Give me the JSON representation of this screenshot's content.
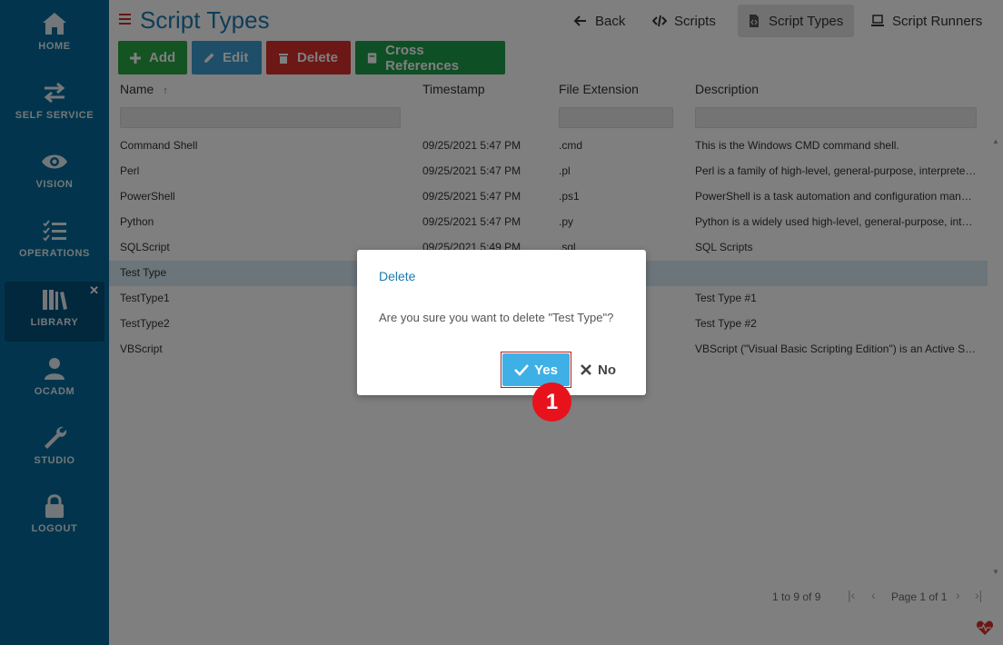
{
  "colors": {
    "sidebar": "#046b9a",
    "accent_blue": "#1a7ab0",
    "add_green": "#28a745",
    "edit_blue": "#3c9dd0",
    "delete_red": "#d9302c",
    "crossref_green": "#1e9e4a",
    "yes_button": "#3fb0e6",
    "badge_red": "#e8121c"
  },
  "sidebar": {
    "items": [
      {
        "label": "HOME",
        "icon": "home-icon"
      },
      {
        "label": "SELF SERVICE",
        "icon": "swap-arrows-icon"
      },
      {
        "label": "VISION",
        "icon": "eye-icon"
      },
      {
        "label": "OPERATIONS",
        "icon": "checklist-icon"
      },
      {
        "label": "LIBRARY",
        "icon": "books-icon",
        "active": true,
        "close": "✕"
      },
      {
        "label": "OCADM",
        "icon": "user-icon"
      },
      {
        "label": "STUDIO",
        "icon": "wrench-icon"
      },
      {
        "label": "LOGOUT",
        "icon": "lock-icon"
      }
    ]
  },
  "header": {
    "title": "Script Types",
    "links": [
      {
        "label": "Back",
        "icon": "arrow-left-icon"
      },
      {
        "label": "Scripts",
        "icon": "code-icon"
      },
      {
        "label": "Script Types",
        "icon": "file-code-icon",
        "active": true
      },
      {
        "label": "Script Runners",
        "icon": "laptop-icon"
      }
    ]
  },
  "toolbar": {
    "add": "Add",
    "edit": "Edit",
    "delete": "Delete",
    "cross_references": "Cross References"
  },
  "grid": {
    "columns": [
      "Name",
      "Timestamp",
      "File Extension",
      "Description"
    ],
    "sort_indicator": "↑",
    "rows": [
      {
        "name": "Command Shell",
        "timestamp": "09/25/2021 5:47 PM",
        "ext": ".cmd",
        "desc": "This is the Windows CMD command shell."
      },
      {
        "name": "Perl",
        "timestamp": "09/25/2021 5:47 PM",
        "ext": ".pl",
        "desc": "Perl is a family of high-level, general-purpose, interprete…"
      },
      {
        "name": "PowerShell",
        "timestamp": "09/25/2021 5:47 PM",
        "ext": ".ps1",
        "desc": "PowerShell is a task automation and configuration man…"
      },
      {
        "name": "Python",
        "timestamp": "09/25/2021 5:47 PM",
        "ext": ".py",
        "desc": "Python is a widely used high-level, general-purpose, inte…"
      },
      {
        "name": "SQLScript",
        "timestamp": "09/25/2021 5:49 PM",
        "ext": ".sql",
        "desc": "SQL Scripts"
      },
      {
        "name": "Test Type",
        "timestamp": "",
        "ext": "",
        "desc": "",
        "selected": true
      },
      {
        "name": "TestType1",
        "timestamp": "",
        "ext": "",
        "desc": "Test Type #1"
      },
      {
        "name": "TestType2",
        "timestamp": "",
        "ext": "",
        "desc": "Test Type #2"
      },
      {
        "name": "VBScript",
        "timestamp": "",
        "ext": "",
        "desc": "VBScript (\"Visual Basic Scripting Edition\") is an Active Scr…"
      }
    ]
  },
  "pager": {
    "summary": "1 to 9 of 9",
    "page": "Page 1 of 1"
  },
  "dialog": {
    "title": "Delete",
    "message": "Are you sure you want to delete \"Test Type\"?",
    "yes": "Yes",
    "no": "No"
  },
  "step_badge": "1"
}
